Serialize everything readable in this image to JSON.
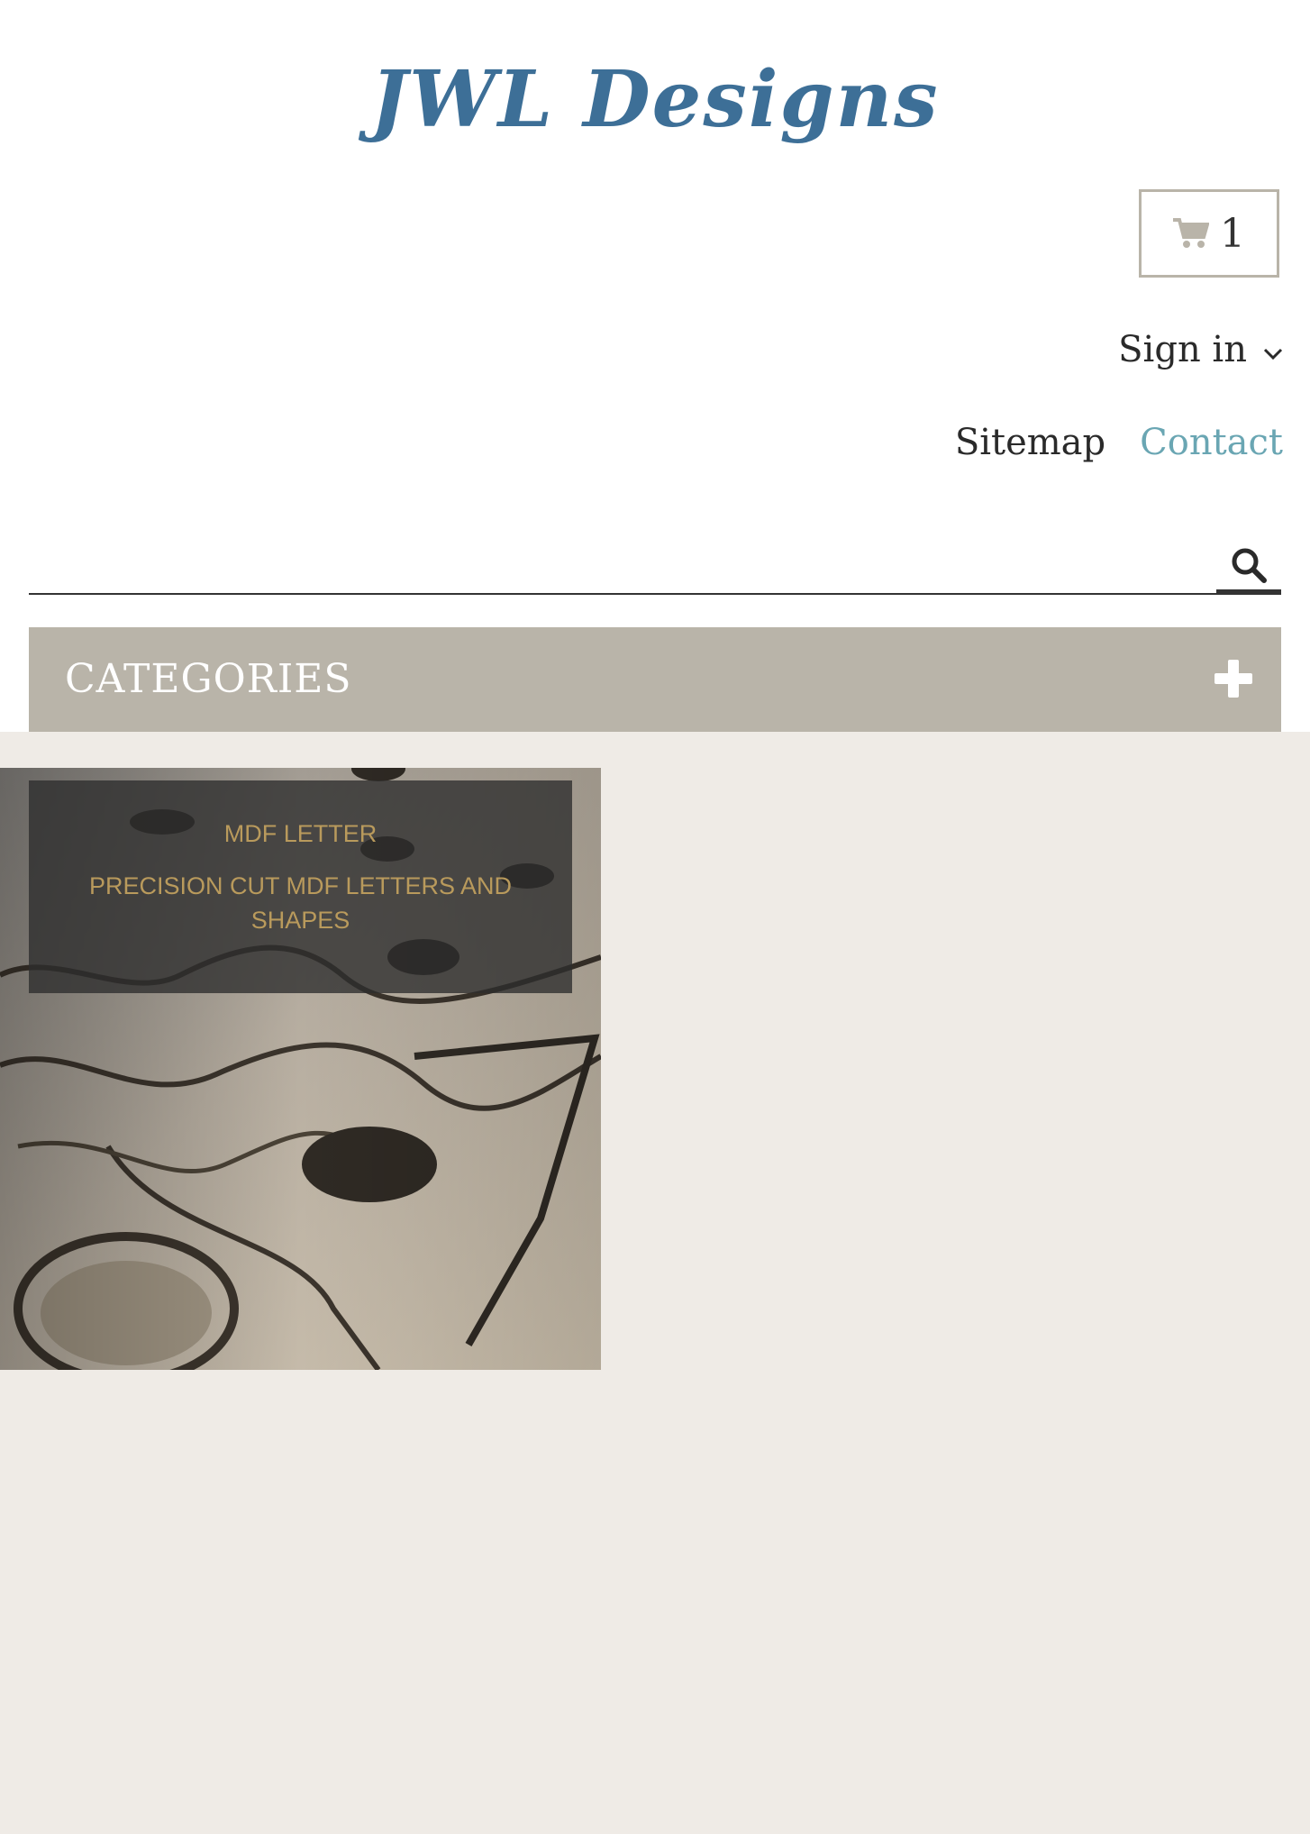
{
  "header": {
    "logo_text": "JWL Designs",
    "cart": {
      "count": "1",
      "icon": "cart-icon"
    },
    "signin_label": "Sign in",
    "links": {
      "sitemap": "Sitemap",
      "contact": "Contact"
    },
    "search": {
      "placeholder": "",
      "icon": "search-icon"
    },
    "categories_label": "CATEGORIES"
  },
  "main": {
    "category_tile": {
      "title": "MDF LETTER",
      "subtitle": "PRECISION CUT MDF LETTERS AND SHAPES"
    }
  },
  "colors": {
    "logo": "#3d6f97",
    "contact_link": "#6aa6b3",
    "categories_bar": "#b9b4a9",
    "main_bg": "#efebe6",
    "tile_text": "#b99a5c"
  }
}
